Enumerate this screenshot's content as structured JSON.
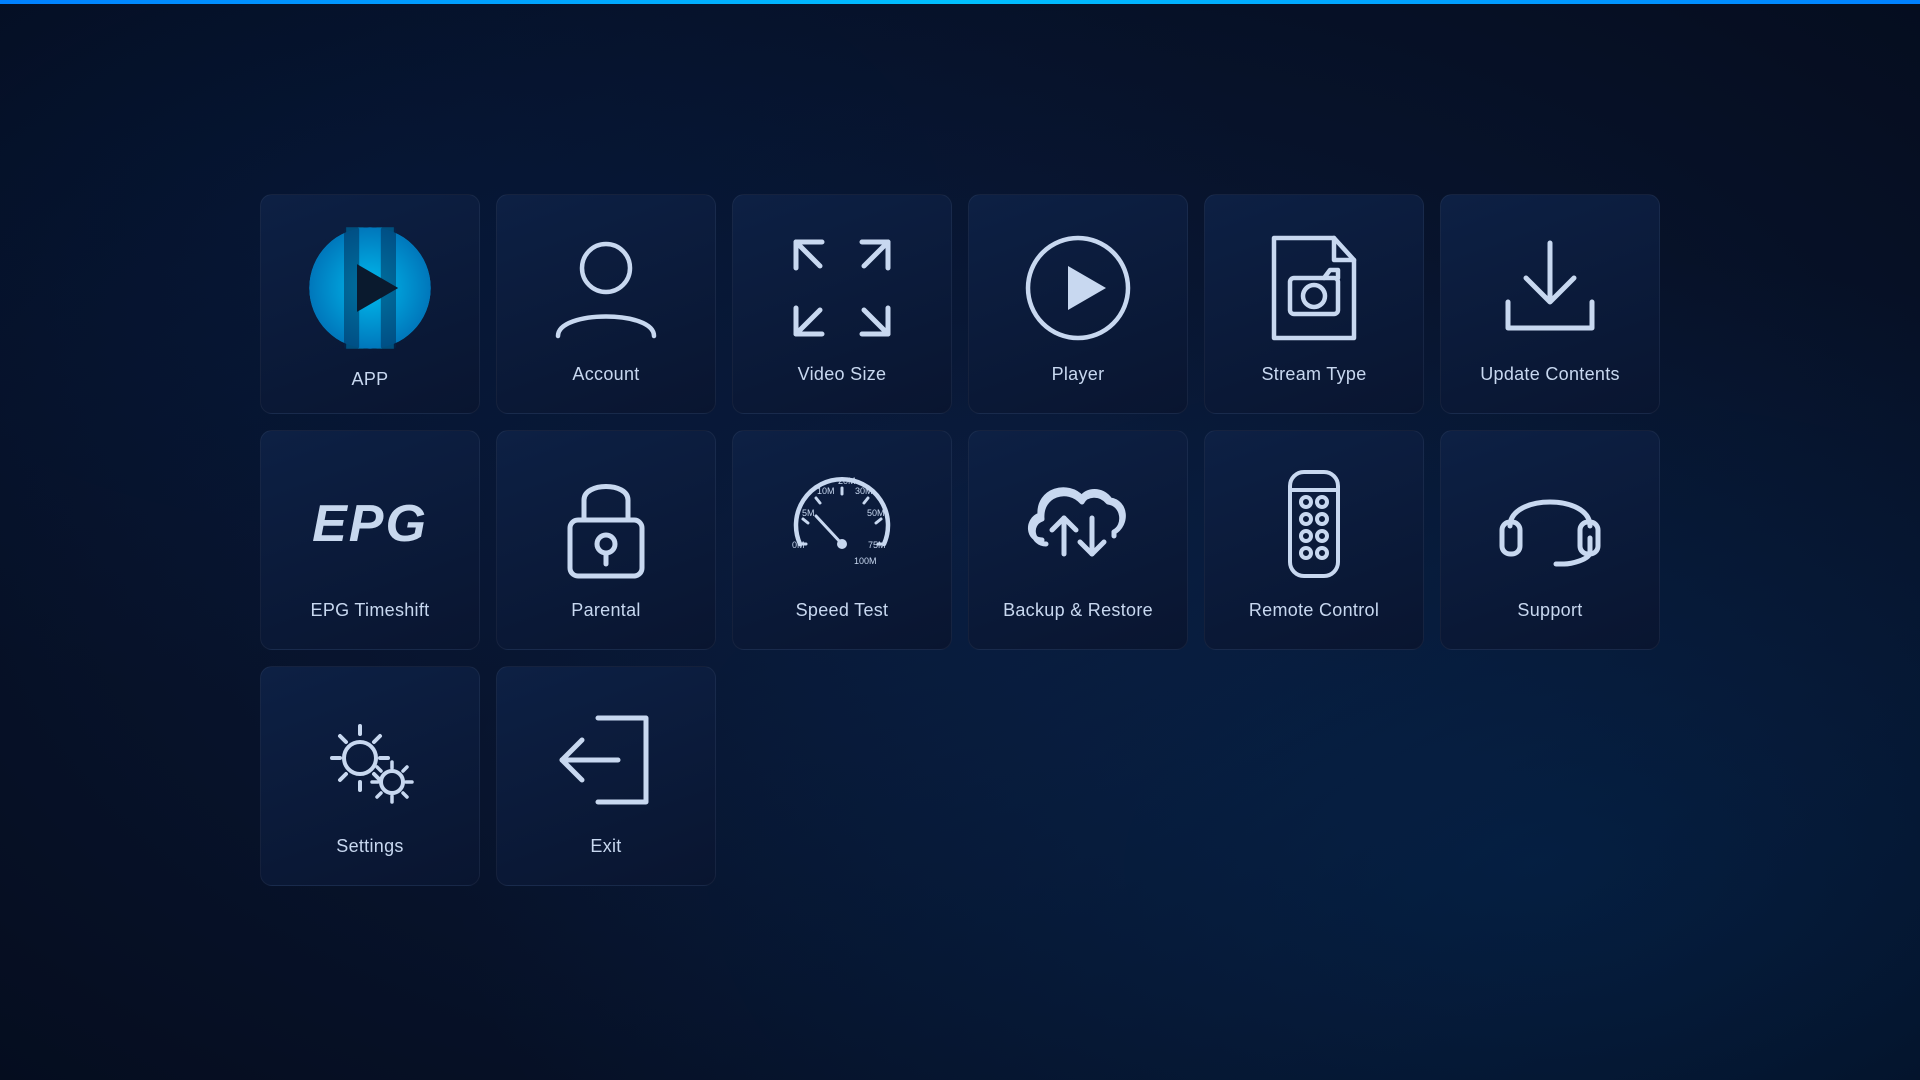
{
  "tiles": [
    {
      "id": "app",
      "label": "APP",
      "type": "app"
    },
    {
      "id": "account",
      "label": "Account",
      "type": "account"
    },
    {
      "id": "video-size",
      "label": "Video Size",
      "type": "video-size"
    },
    {
      "id": "player",
      "label": "Player",
      "type": "player"
    },
    {
      "id": "stream-type",
      "label": "Stream Type",
      "type": "stream-type"
    },
    {
      "id": "update-contents",
      "label": "Update Contents",
      "type": "update-contents"
    },
    {
      "id": "epg-timeshift",
      "label": "EPG Timeshift",
      "type": "epg"
    },
    {
      "id": "parental",
      "label": "Parental",
      "type": "parental"
    },
    {
      "id": "speed-test",
      "label": "Speed Test",
      "type": "speed-test"
    },
    {
      "id": "backup-restore",
      "label": "Backup & Restore",
      "type": "backup-restore"
    },
    {
      "id": "remote-control",
      "label": "Remote Control",
      "type": "remote-control"
    },
    {
      "id": "support",
      "label": "Support",
      "type": "support"
    },
    {
      "id": "settings",
      "label": "Settings",
      "type": "settings"
    },
    {
      "id": "exit",
      "label": "Exit",
      "type": "exit"
    },
    {
      "id": "empty1",
      "label": "",
      "type": "empty"
    },
    {
      "id": "empty2",
      "label": "",
      "type": "empty"
    },
    {
      "id": "empty3",
      "label": "",
      "type": "empty"
    },
    {
      "id": "empty4",
      "label": "",
      "type": "empty"
    }
  ]
}
